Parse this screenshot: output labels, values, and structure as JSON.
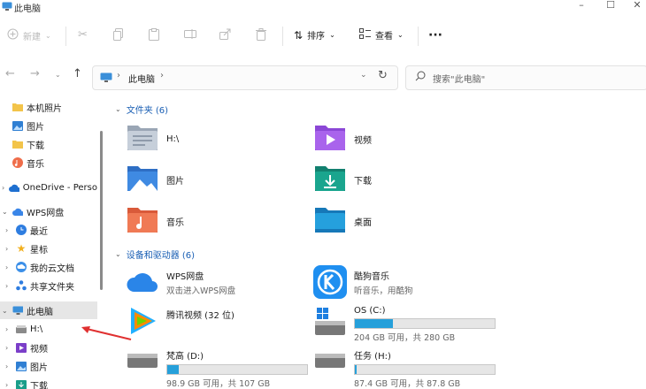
{
  "window": {
    "title": "此电脑",
    "controls": [
      "–",
      "☐",
      "✕"
    ]
  },
  "toolbar": {
    "new_label": "新建",
    "sort_label": "排序",
    "view_label": "查看",
    "more_label": "···"
  },
  "address": {
    "path": "此电脑",
    "separator": "›",
    "search_placeholder": "搜索\"此电脑\""
  },
  "sidebar": {
    "items": [
      {
        "label": "本机照片",
        "icon": "folder-icon"
      },
      {
        "label": "图片",
        "icon": "pictures-icon"
      },
      {
        "label": "下载",
        "icon": "folder-icon"
      },
      {
        "label": "音乐",
        "icon": "music-icon"
      },
      {
        "label": "OneDrive - Perso",
        "icon": "cloud-icon"
      },
      {
        "label": "WPS网盘",
        "icon": "cloud-icon"
      },
      {
        "label": "最近",
        "icon": "clock-icon"
      },
      {
        "label": "星标",
        "icon": "star-icon"
      },
      {
        "label": "我的云文档",
        "icon": "cloud-doc-icon"
      },
      {
        "label": "共享文件夹",
        "icon": "share-icon"
      },
      {
        "label": "此电脑",
        "icon": "computer-icon"
      },
      {
        "label": "H:\\",
        "icon": "drive-icon"
      },
      {
        "label": "视频",
        "icon": "video-icon"
      },
      {
        "label": "图片",
        "icon": "pictures-icon"
      },
      {
        "label": "下载",
        "icon": "download-icon"
      }
    ]
  },
  "folders": {
    "header": "文件夹 (6)",
    "items": [
      {
        "name": "H:\\",
        "icon": "drive-folder-icon"
      },
      {
        "name": "视频",
        "icon": "video-folder-icon"
      },
      {
        "name": "图片",
        "icon": "pictures-folder-icon"
      },
      {
        "name": "下载",
        "icon": "download-folder-icon"
      },
      {
        "name": "音乐",
        "icon": "music-folder-icon"
      },
      {
        "name": "桌面",
        "icon": "desktop-folder-icon"
      }
    ]
  },
  "devices": {
    "header": "设备和驱动器 (6)",
    "items": [
      {
        "name": "WPS网盘",
        "sub": "双击进入WPS网盘",
        "icon": "wps-cloud-icon"
      },
      {
        "name": "酷狗音乐",
        "sub": "听音乐，用酷狗",
        "icon": "kugou-icon"
      },
      {
        "name": "腾讯视频 (32 位)",
        "icon": "tencent-video-icon"
      },
      {
        "name": "OS (C:)",
        "sub": "204 GB 可用，共 280 GB",
        "used_fraction": 0.27,
        "icon": "windows-drive-icon"
      },
      {
        "name": "梵高 (D:)",
        "sub": "98.9 GB 可用，共 107 GB",
        "used_fraction": 0.08,
        "icon": "drive-icon"
      },
      {
        "name": "任务 (H:)",
        "sub": "87.4 GB 可用，共 87.8 GB",
        "used_fraction": 0.01,
        "icon": "drive-icon"
      }
    ]
  },
  "colors": {
    "accent": "#26a0da",
    "annotation_arrow": "#e03030",
    "header_text": "#1a5fb4"
  }
}
